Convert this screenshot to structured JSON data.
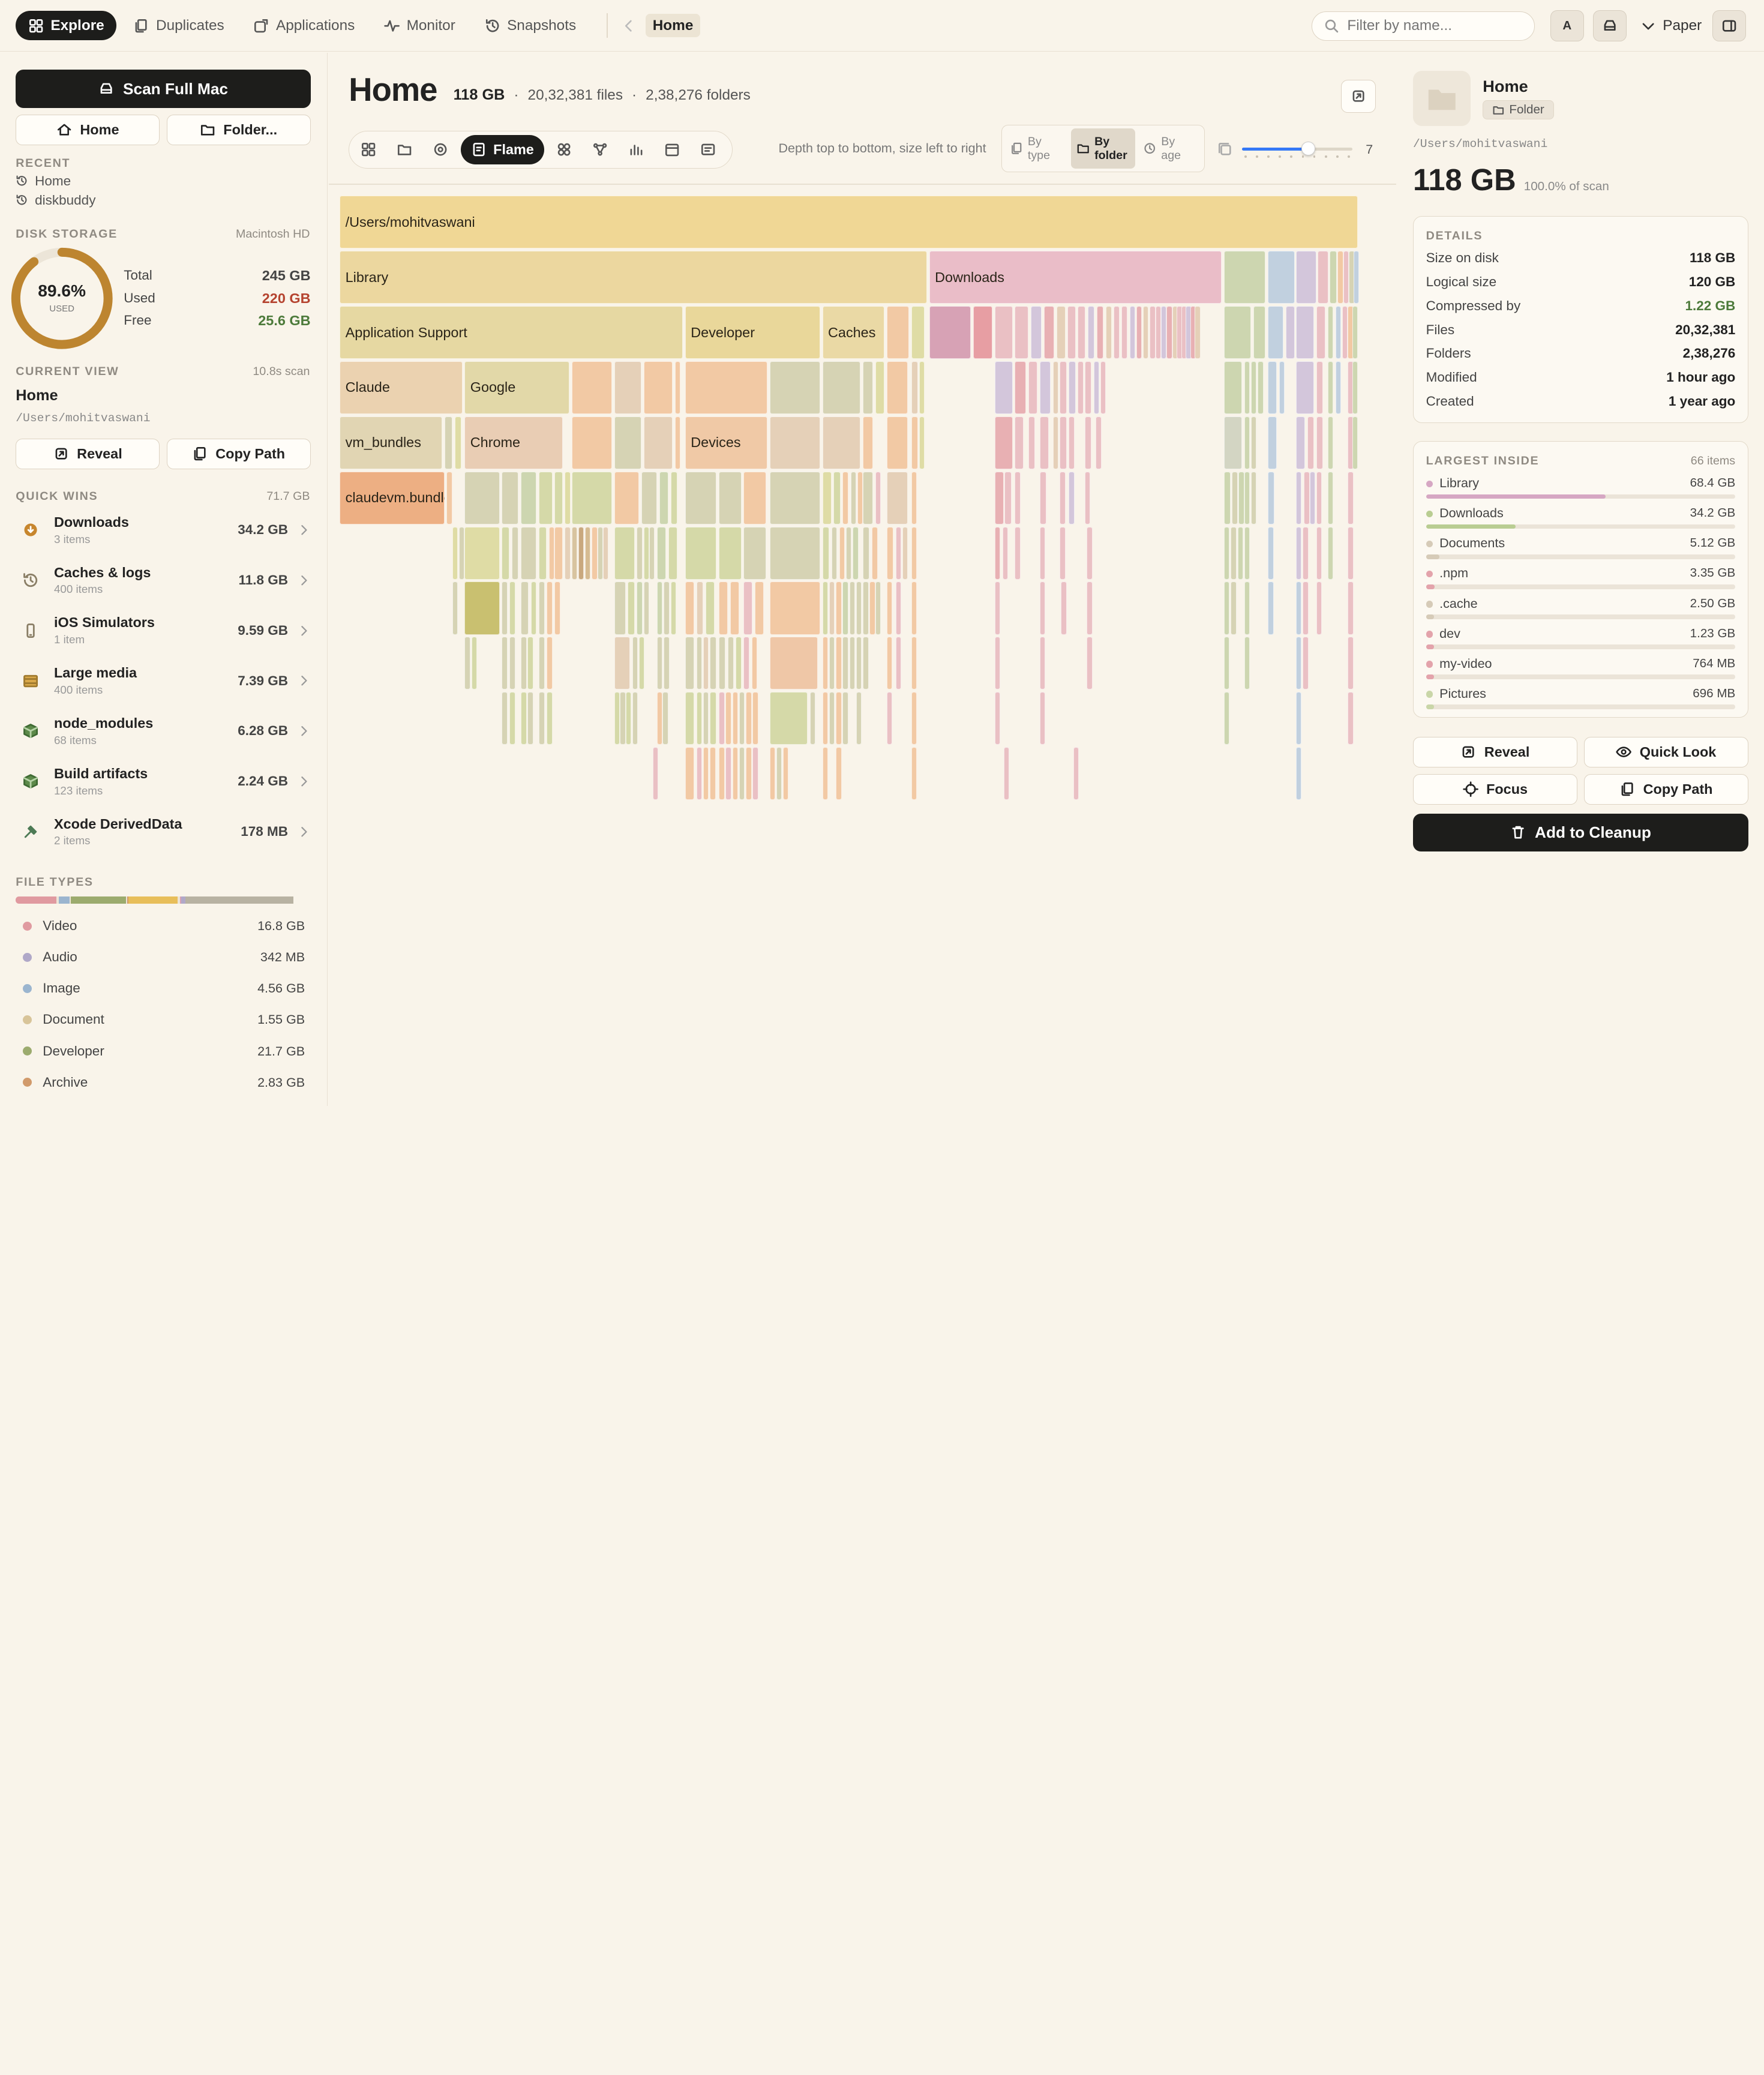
{
  "nav": {
    "tabs": [
      {
        "label": "Explore",
        "icon": "grid-icon"
      },
      {
        "label": "Duplicates",
        "icon": "copy-icon"
      },
      {
        "label": "Applications",
        "icon": "app-icon"
      },
      {
        "label": "Monitor",
        "icon": "pulse-icon"
      },
      {
        "label": "Snapshots",
        "icon": "history-icon"
      }
    ],
    "breadcrumb": "Home"
  },
  "search": {
    "placeholder": "Filter by name..."
  },
  "topright": {
    "account_label": "A",
    "theme_label": "Paper"
  },
  "sidebar": {
    "scan_label": "Scan Full Mac",
    "home_label": "Home",
    "folder_label": "Folder...",
    "recent_title": "RECENT",
    "recent": [
      "Home",
      "diskbuddy"
    ],
    "disk_title": "DISK STORAGE",
    "disk_name": "Macintosh HD",
    "used_pct_text": "89.6%",
    "used_pct": 89.6,
    "used_caption": "USED",
    "stats": [
      {
        "label": "Total",
        "value": "245 GB"
      },
      {
        "label": "Used",
        "value": "220 GB"
      },
      {
        "label": "Free",
        "value": "25.6 GB"
      }
    ],
    "view_title": "CURRENT VIEW",
    "view_time": "10.8s scan",
    "view_name": "Home",
    "view_path": "/Users/mohitvaswani",
    "reveal_label": "Reveal",
    "copy_label": "Copy Path",
    "qw_title": "QUICK WINS",
    "qw_total": "71.7 GB",
    "quickwins": [
      {
        "name": "Downloads",
        "sub": "3 items",
        "value": "34.2 GB",
        "icon": "download-icon"
      },
      {
        "name": "Caches & logs",
        "sub": "400 items",
        "value": "11.8 GB",
        "icon": "history-icon"
      },
      {
        "name": "iOS Simulators",
        "sub": "1 item",
        "value": "9.59 GB",
        "icon": "phone-icon"
      },
      {
        "name": "Large media",
        "sub": "400 items",
        "value": "7.39 GB",
        "icon": "film-icon"
      },
      {
        "name": "node_modules",
        "sub": "68 items",
        "value": "6.28 GB",
        "icon": "package-icon"
      },
      {
        "name": "Build artifacts",
        "sub": "123 items",
        "value": "2.24 GB",
        "icon": "package-icon"
      },
      {
        "name": "Xcode DerivedData",
        "sub": "2 items",
        "value": "178 MB",
        "icon": "hammer-icon"
      }
    ],
    "ft_title": "FILE TYPES",
    "filetypes": [
      {
        "name": "Video",
        "value": "16.8 GB",
        "color": "#e09aa0"
      },
      {
        "name": "Audio",
        "value": "342 MB",
        "color": "#b0a8c8"
      },
      {
        "name": "Image",
        "value": "4.56 GB",
        "color": "#9bb5cf"
      },
      {
        "name": "Document",
        "value": "1.55 GB",
        "color": "#d8c499"
      },
      {
        "name": "Developer",
        "value": "21.7 GB",
        "color": "#9cab6e"
      },
      {
        "name": "Archive",
        "value": "2.83 GB",
        "color": "#d19a6b"
      }
    ]
  },
  "main": {
    "title": "Home",
    "size": "118 GB",
    "files": "20,32,381 files",
    "folders": "2,38,276 folders",
    "dot": "·",
    "active_view": "Flame",
    "hint": "Depth top to bottom, size left to right",
    "modes": [
      {
        "l1": "By",
        "l2": "type"
      },
      {
        "l1": "By",
        "l2": "folder"
      },
      {
        "l1": "By",
        "l2": "age"
      }
    ],
    "depth_value": "7",
    "depth": 7
  },
  "details": {
    "name": "Home",
    "type": "Folder",
    "path": "/Users/mohitvaswani",
    "size": "118 GB",
    "pct": "100.0% of scan",
    "details_title": "DETAILS",
    "rows": [
      {
        "label": "Size on disk",
        "value": "118 GB"
      },
      {
        "label": "Logical size",
        "value": "120 GB"
      },
      {
        "label": "Compressed by",
        "value": "1.22 GB"
      },
      {
        "label": "Files",
        "value": "20,32,381"
      },
      {
        "label": "Folders",
        "value": "2,38,276"
      },
      {
        "label": "Modified",
        "value": "1 hour ago"
      },
      {
        "label": "Created",
        "value": "1 year ago"
      }
    ],
    "largest_title": "LARGEST INSIDE",
    "largest_count": "66 items",
    "largest": [
      {
        "name": "Library",
        "value": "68.4 GB",
        "pct": 0.58,
        "color": "#d6a7c3"
      },
      {
        "name": "Downloads",
        "value": "34.2 GB",
        "pct": 0.29,
        "color": "#b9cd92"
      },
      {
        "name": "Documents",
        "value": "5.12 GB",
        "pct": 0.043,
        "color": "#d6cbb8"
      },
      {
        "name": ".npm",
        "value": "3.35 GB",
        "pct": 0.028,
        "color": "#e3a3ab"
      },
      {
        "name": ".cache",
        "value": "2.50 GB",
        "pct": 0.021,
        "color": "#d6cbb8"
      },
      {
        "name": "dev",
        "value": "1.23 GB",
        "pct": 0.01,
        "color": "#e3a3ab"
      },
      {
        "name": "my-video",
        "value": "764 MB",
        "pct": 0.006,
        "color": "#e3a3ab"
      },
      {
        "name": "Pictures",
        "value": "696 MB",
        "pct": 0.006,
        "color": "#c9d6a8"
      }
    ],
    "actions": {
      "reveal": "Reveal",
      "quicklook": "Quick Look",
      "focus": "Focus",
      "copy": "Copy Path",
      "cleanup": "Add to Cleanup"
    }
  },
  "flame_labels": {
    "root": "/Users/mohitvaswani",
    "library": "Library",
    "downloads": "Downloads",
    "appsupport": "Application Support",
    "developer": "Developer",
    "caches": "Caches",
    "claude": "Claude",
    "google": "Google",
    "vmbundles": "vm_bundles",
    "chrome": "Chrome",
    "devices": "Devices",
    "claudevm": "claudevm.bundle"
  }
}
